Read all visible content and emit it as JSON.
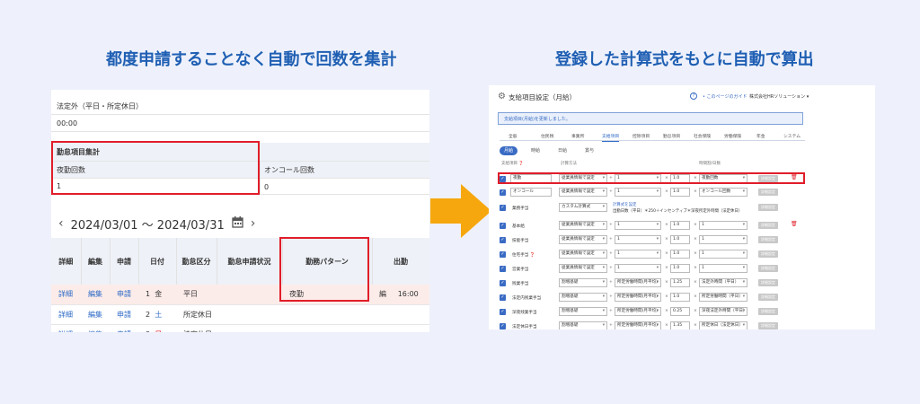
{
  "headings": {
    "left": "都度申請することなく自動で回数を集計",
    "right": "登録した計算式をもとに自動で算出"
  },
  "left": {
    "legal_label": "法定外（平日・所定休日）",
    "legal_value": "00:00",
    "agg_title": "勤怠項目集計",
    "night_count_label": "夜勤回数",
    "night_count_value": "1",
    "oncall_label": "オンコール回数",
    "oncall_value": "0",
    "date_range": "2024/03/01 〜 2024/03/31",
    "prev": "‹",
    "next": "›",
    "columns": [
      "詳細",
      "編集",
      "申請",
      "日付",
      "勤怠区分",
      "勤怠申請状況",
      "勤務パターン",
      "出勤"
    ],
    "rows": [
      {
        "detail": "詳細",
        "edit": "編集",
        "apply": "申請",
        "day": "1",
        "dow": "金",
        "kind": "平日",
        "status": "",
        "pattern": "夜勤",
        "extra": "編",
        "time": "16:00"
      },
      {
        "detail": "詳細",
        "edit": "編集",
        "apply": "申請",
        "day": "2",
        "dow": "土",
        "kind": "所定休日",
        "status": "",
        "pattern": "",
        "extra": "",
        "time": ""
      },
      {
        "detail": "詳細",
        "edit": "編集",
        "apply": "申請",
        "day": "3",
        "dow": "日",
        "kind": "法定休日",
        "status": "",
        "pattern": "",
        "extra": "",
        "time": ""
      }
    ]
  },
  "right": {
    "title": "支給項目設定（月給）",
    "guide_link": "• このページのガイド",
    "company": "株式会社HRソリューション ▾",
    "notice": "支給項目(月給)を更新しました。",
    "tabs": [
      "全般",
      "住民税",
      "事業所",
      "支給項目",
      "控除項目",
      "勤怠項目",
      "社会保険",
      "労働保険",
      "年金",
      "システム"
    ],
    "subtabs": [
      "月給",
      "時給",
      "日給",
      "賞与"
    ],
    "col_headers": {
      "item": "支給項目 ❓",
      "method": "計算方法",
      "params": "時間割/日数"
    },
    "rows": [
      {
        "name": "夜勤",
        "source": "従業員情報で設定",
        "v1": "1",
        "op1": "×",
        "v2": "1.0",
        "op2": "×",
        "v3": "夜勤回数",
        "detail": "詳細設定",
        "trash": true,
        "editable": true
      },
      {
        "name": "オンコール",
        "source": "従業員情報で設定",
        "v1": "1",
        "op1": "×",
        "v2": "1.0",
        "op2": "×",
        "v3": "オンコール回数",
        "detail": "詳細設定",
        "trash": false,
        "editable": true
      },
      {
        "name": "業務手当",
        "source": "カスタム計算式",
        "custom_link": "計算式を設定",
        "custom_formula": "出勤日数（平日）＊250＋インセンティブ＊深夜所定外時間（法定休日）",
        "detail": "詳細設定",
        "trash": false
      },
      {
        "name": "基本給",
        "source": "従業員情報で設定",
        "v1": "1",
        "op1": "×",
        "v2": "1.0",
        "op2": "×",
        "v3": "1",
        "detail": "詳細設定",
        "trash": true
      },
      {
        "name": "技能手当",
        "source": "従業員情報で設定",
        "v1": "1",
        "op1": "×",
        "v2": "1.0",
        "op2": "×",
        "v3": "1",
        "detail": "詳細設定",
        "trash": false
      },
      {
        "name": "住宅手当 ❓",
        "source": "従業員情報で設定",
        "v1": "1",
        "op1": "×",
        "v2": "1.0",
        "op2": "×",
        "v3": "1",
        "detail": "詳細設定",
        "trash": false
      },
      {
        "name": "営業手当",
        "source": "従業員情報で設定",
        "v1": "1",
        "op1": "×",
        "v2": "1.0",
        "op2": "×",
        "v3": "1",
        "detail": "詳細設定",
        "trash": false
      },
      {
        "name": "残業手当",
        "source": "割増基礎",
        "v1": "所定労働時間(月平均)",
        "op1": "×",
        "v2": "1.25",
        "op2": "×",
        "v3": "法定外時間（平日）",
        "detail": "詳細設定",
        "trash": false
      },
      {
        "name": "法定内残業手当",
        "source": "割増基礎",
        "v1": "所定労働時間(月平均)",
        "op1": "×",
        "v2": "1.0",
        "op2": "×",
        "v3": "所定労働時間（平日）",
        "detail": "詳細設定",
        "trash": false
      },
      {
        "name": "深夜残業手当",
        "source": "割増基礎",
        "v1": "所定労働時間(月平均)",
        "op1": "×",
        "v2": "0.25",
        "op2": "×",
        "v3": "深夜法定外時間（平日）",
        "detail": "詳細設定",
        "trash": false
      },
      {
        "name": "法定休日手当",
        "source": "割増基礎",
        "v1": "所定労働時間(月平均)",
        "op1": "×",
        "v2": "1.35",
        "op2": "×",
        "v3": "所定休日（法定休日）",
        "detail": "詳細設定",
        "trash": false
      }
    ]
  },
  "colors": {
    "accent": "#1f5fb3",
    "highlight": "#e11d2a",
    "arrow": "#f6a70e"
  }
}
